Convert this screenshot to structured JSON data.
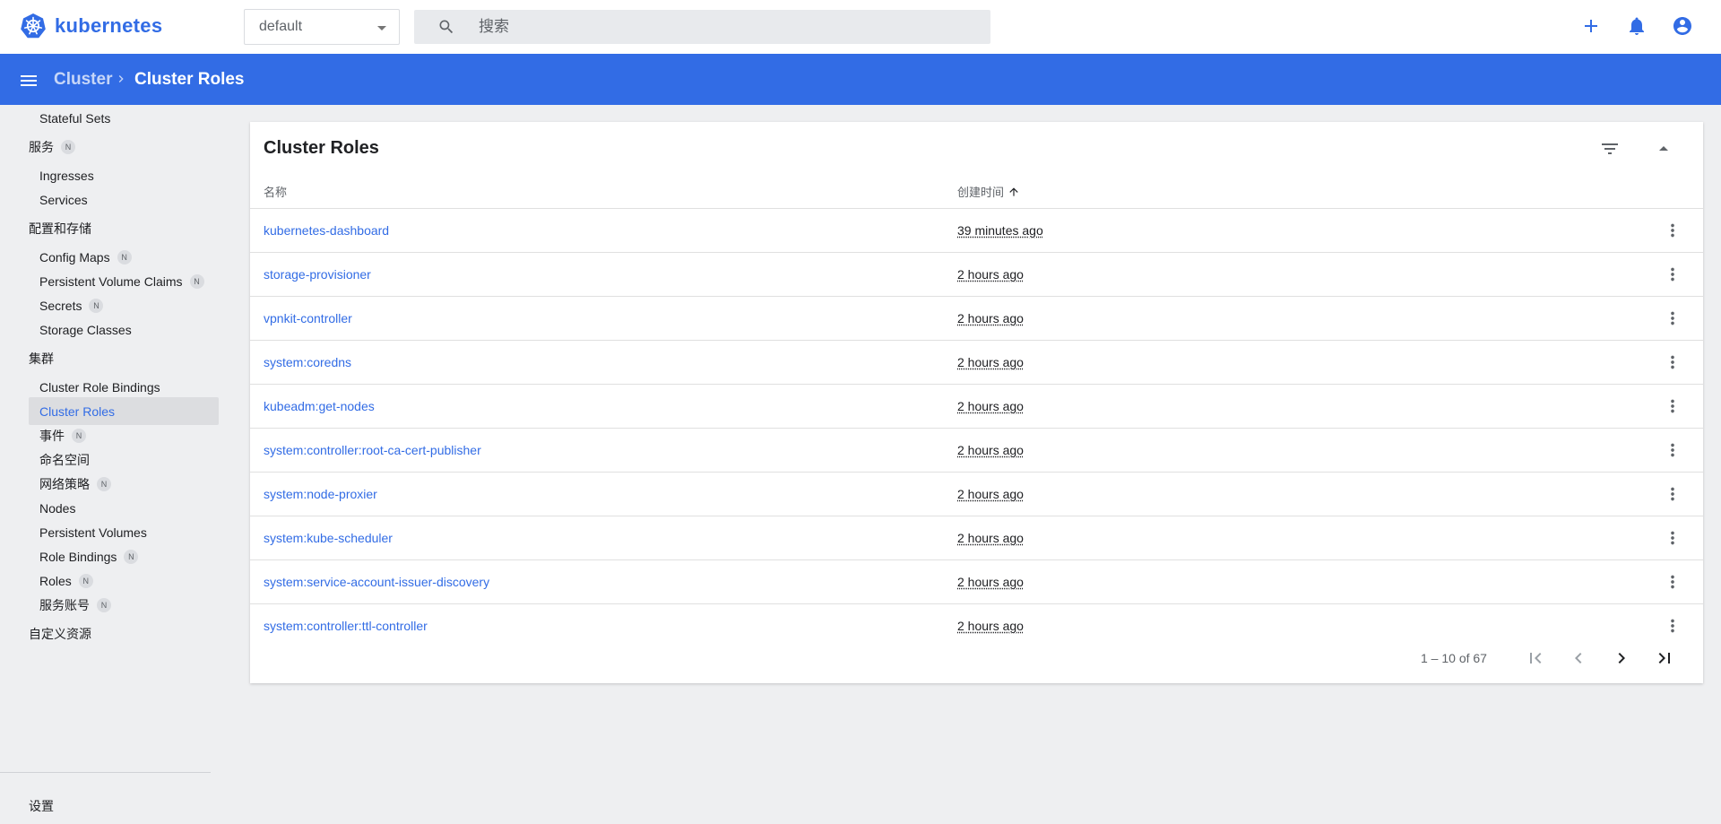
{
  "app": {
    "name": "kubernetes"
  },
  "header": {
    "namespace": "default",
    "search_placeholder": "搜索",
    "icons": [
      "add-icon",
      "notifications-icon",
      "account-circle-icon"
    ]
  },
  "toolbar": {
    "breadcrumb_parent": "Cluster",
    "breadcrumb_current": "Cluster Roles"
  },
  "sidebar": {
    "items": [
      {
        "label": "Stateful Sets",
        "type": "item"
      },
      {
        "label": "服务",
        "type": "group",
        "badge": "N"
      },
      {
        "label": "Ingresses",
        "type": "item"
      },
      {
        "label": "Services",
        "type": "item"
      },
      {
        "label": "配置和存储",
        "type": "group"
      },
      {
        "label": "Config Maps",
        "type": "item",
        "badge": "N"
      },
      {
        "label": "Persistent Volume Claims",
        "type": "item",
        "badge": "N"
      },
      {
        "label": "Secrets",
        "type": "item",
        "badge": "N"
      },
      {
        "label": "Storage Classes",
        "type": "item"
      },
      {
        "label": "集群",
        "type": "group"
      },
      {
        "label": "Cluster Role Bindings",
        "type": "item"
      },
      {
        "label": "Cluster Roles",
        "type": "item",
        "active": true
      },
      {
        "label": "事件",
        "type": "item",
        "badge": "N"
      },
      {
        "label": "命名空间",
        "type": "item"
      },
      {
        "label": "网络策略",
        "type": "item",
        "badge": "N"
      },
      {
        "label": "Nodes",
        "type": "item"
      },
      {
        "label": "Persistent Volumes",
        "type": "item"
      },
      {
        "label": "Role Bindings",
        "type": "item",
        "badge": "N"
      },
      {
        "label": "Roles",
        "type": "item",
        "badge": "N"
      },
      {
        "label": "服务账号",
        "type": "item",
        "badge": "N"
      },
      {
        "label": "自定义资源",
        "type": "group"
      },
      {
        "label": "设置",
        "type": "group"
      }
    ]
  },
  "card": {
    "title": "Cluster Roles",
    "columns": {
      "name": "名称",
      "created": "创建时间"
    },
    "rows": [
      {
        "name": "kubernetes-dashboard",
        "created": "39 minutes ago"
      },
      {
        "name": "storage-provisioner",
        "created": "2 hours ago"
      },
      {
        "name": "vpnkit-controller",
        "created": "2 hours ago"
      },
      {
        "name": "system:coredns",
        "created": "2 hours ago"
      },
      {
        "name": "kubeadm:get-nodes",
        "created": "2 hours ago"
      },
      {
        "name": "system:controller:root-ca-cert-publisher",
        "created": "2 hours ago"
      },
      {
        "name": "system:node-proxier",
        "created": "2 hours ago"
      },
      {
        "name": "system:kube-scheduler",
        "created": "2 hours ago"
      },
      {
        "name": "system:service-account-issuer-discovery",
        "created": "2 hours ago"
      },
      {
        "name": "system:controller:ttl-controller",
        "created": "2 hours ago"
      }
    ],
    "pagination": {
      "range": "1 – 10 of 67"
    }
  },
  "colors": {
    "accent": "#326ce5",
    "active_bg": "#dcdde0",
    "page_bg": "#eeeff1"
  }
}
